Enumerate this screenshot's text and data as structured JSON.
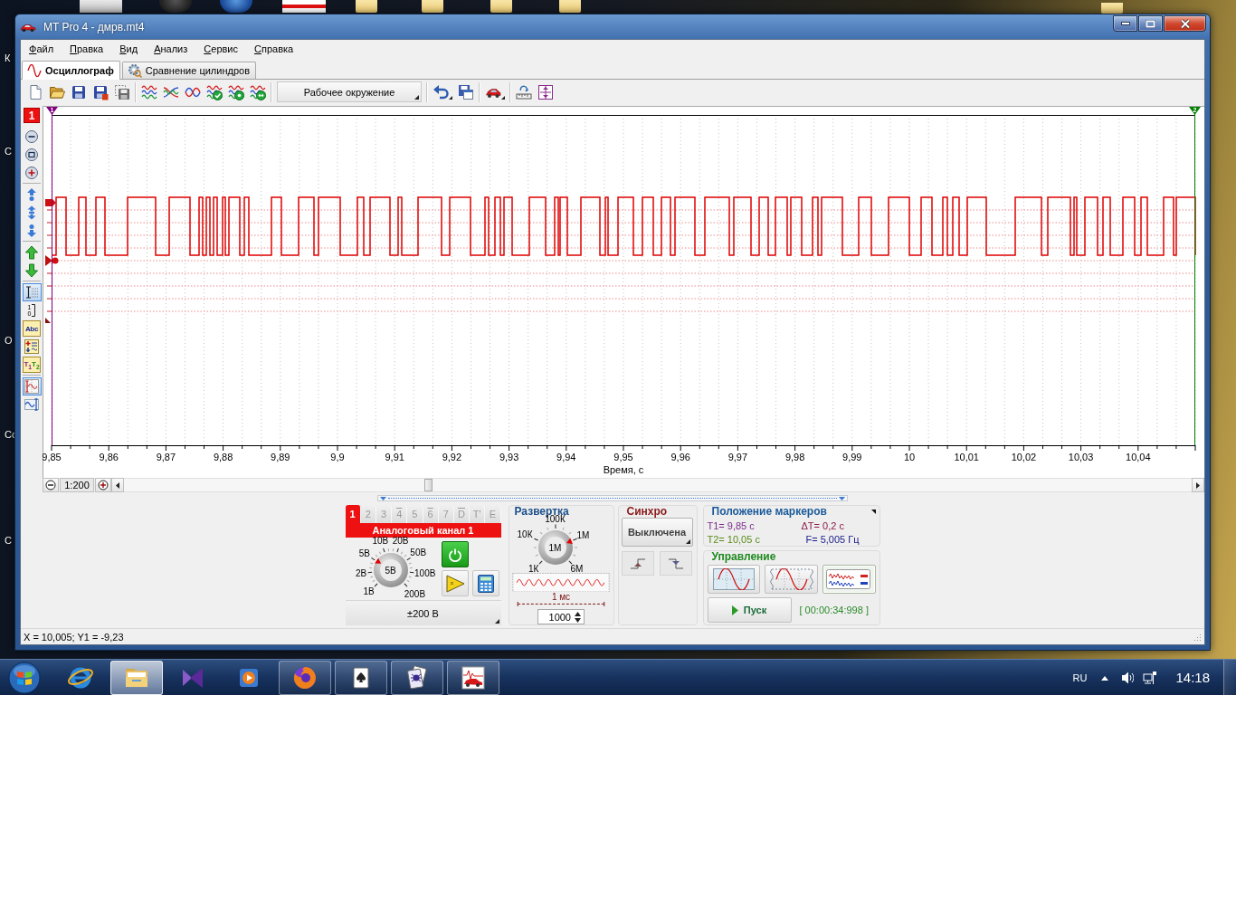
{
  "desktop": {
    "icon_labels": [
      "К",
      "С",
      "О",
      "Сс",
      "С"
    ]
  },
  "window": {
    "title": "MT Pro 4 - дмрв.mt4"
  },
  "menu": [
    "Файл",
    "Правка",
    "Вид",
    "Анализ",
    "Сервис",
    "Справка"
  ],
  "tabs": [
    {
      "label": "Осциллограф",
      "selected": true
    },
    {
      "label": "Сравнение цилиндров",
      "selected": false
    }
  ],
  "toolbar": {
    "environment_button": "Рабочее окружение"
  },
  "side_toolbar": {
    "channel_badge": "1",
    "tools": [
      {
        "kind": "cursor",
        "selected": true
      },
      {
        "kind": "scale",
        "selected": false,
        "texts": [
          "1",
          "0"
        ]
      },
      {
        "kind": "text",
        "selected": false,
        "texts": [
          "Abc"
        ]
      },
      {
        "kind": "levels",
        "selected": false
      },
      {
        "kind": "markers",
        "selected": false,
        "texts": [
          "T$_{1}$",
          "T$_{2}$"
        ]
      },
      {
        "kind": "chart",
        "selected": true
      },
      {
        "kind": "wave",
        "selected": false
      }
    ]
  },
  "chart": {
    "markers": [
      {
        "label": "1",
        "color": "#800080"
      },
      {
        "label": "2",
        "color": "#008000"
      }
    ],
    "x_tick_labels": [
      "9,85",
      "9,86",
      "9,87",
      "9,88",
      "9,89",
      "9,9",
      "9,91",
      "9,92",
      "9,93",
      "9,94",
      "9,95",
      "9,96",
      "9,97",
      "9,98",
      "9,99",
      "10",
      "10,01",
      "10,02",
      "10,03",
      "10,04"
    ],
    "x_axis_label": "Время, с"
  },
  "scroll_bar": {
    "zoom": "1:200"
  },
  "channel_panel": {
    "tabs": [
      {
        "label": "1",
        "selected": true,
        "overline": false
      },
      {
        "label": "2",
        "selected": false,
        "overline": false
      },
      {
        "label": "3",
        "selected": false,
        "overline": false
      },
      {
        "label": "4",
        "selected": false,
        "overline": true
      },
      {
        "label": "5",
        "selected": false,
        "overline": false
      },
      {
        "label": "6",
        "selected": false,
        "overline": true
      },
      {
        "label": "7",
        "selected": false,
        "overline": false
      },
      {
        "label": "D",
        "selected": false,
        "overline": true
      },
      {
        "label": "T'",
        "selected": false,
        "overline": false
      },
      {
        "label": "E",
        "selected": false,
        "overline": false
      }
    ],
    "title": "Аналоговый канал 1",
    "knob": {
      "value": "5В",
      "level": 0.29,
      "scale": [
        "1В",
        "2В",
        "5В",
        "10В",
        "20В",
        "50В",
        "100В",
        "200В"
      ]
    },
    "range": "±200 В"
  },
  "sweep_panel": {
    "title": "Развертка",
    "knob": {
      "value": "1М",
      "level": 0.75,
      "scale": [
        "1К",
        "10К",
        "100К",
        "1М",
        "6М"
      ]
    },
    "time_span": "1 мс",
    "points": "1000"
  },
  "sync_panel": {
    "title": "Синхро",
    "mode": "Выключена",
    "edges": [
      {
        "kind": "rising",
        "selected": false
      },
      {
        "kind": "falling",
        "selected": false
      }
    ]
  },
  "markers_panel": {
    "title": "Положение маркеров",
    "t1": "T1= 9,85 с",
    "delta_t": "ΔT= 0,2 с",
    "t2": "T2= 10,05 с",
    "frequency": "F= 5,005 Гц"
  },
  "control_panel": {
    "title": "Управление",
    "modes": [
      {
        "kind": "single",
        "selected": false
      },
      {
        "kind": "window",
        "selected": false
      },
      {
        "kind": "multi",
        "selected": true
      }
    ],
    "start_button": "Пуск",
    "timer": "[ 00:00:34:998 ]"
  },
  "status_bar": {
    "text": "X = 10,005; Y1 = -9,23"
  },
  "taskbar": {
    "apps": [
      {
        "kind": "ie",
        "running": false,
        "highlighted": false
      },
      {
        "kind": "explorer",
        "running": true,
        "highlighted": true
      },
      {
        "kind": "studio",
        "running": false,
        "highlighted": false
      },
      {
        "kind": "media",
        "running": false,
        "highlighted": false
      },
      {
        "kind": "firefox",
        "running": true,
        "highlighted": false
      },
      {
        "kind": "solitaire",
        "running": true,
        "highlighted": false
      },
      {
        "kind": "spider",
        "running": true,
        "highlighted": false
      },
      {
        "kind": "carapp",
        "running": true,
        "highlighted": false
      }
    ],
    "language": "RU",
    "clock": "14:18"
  }
}
